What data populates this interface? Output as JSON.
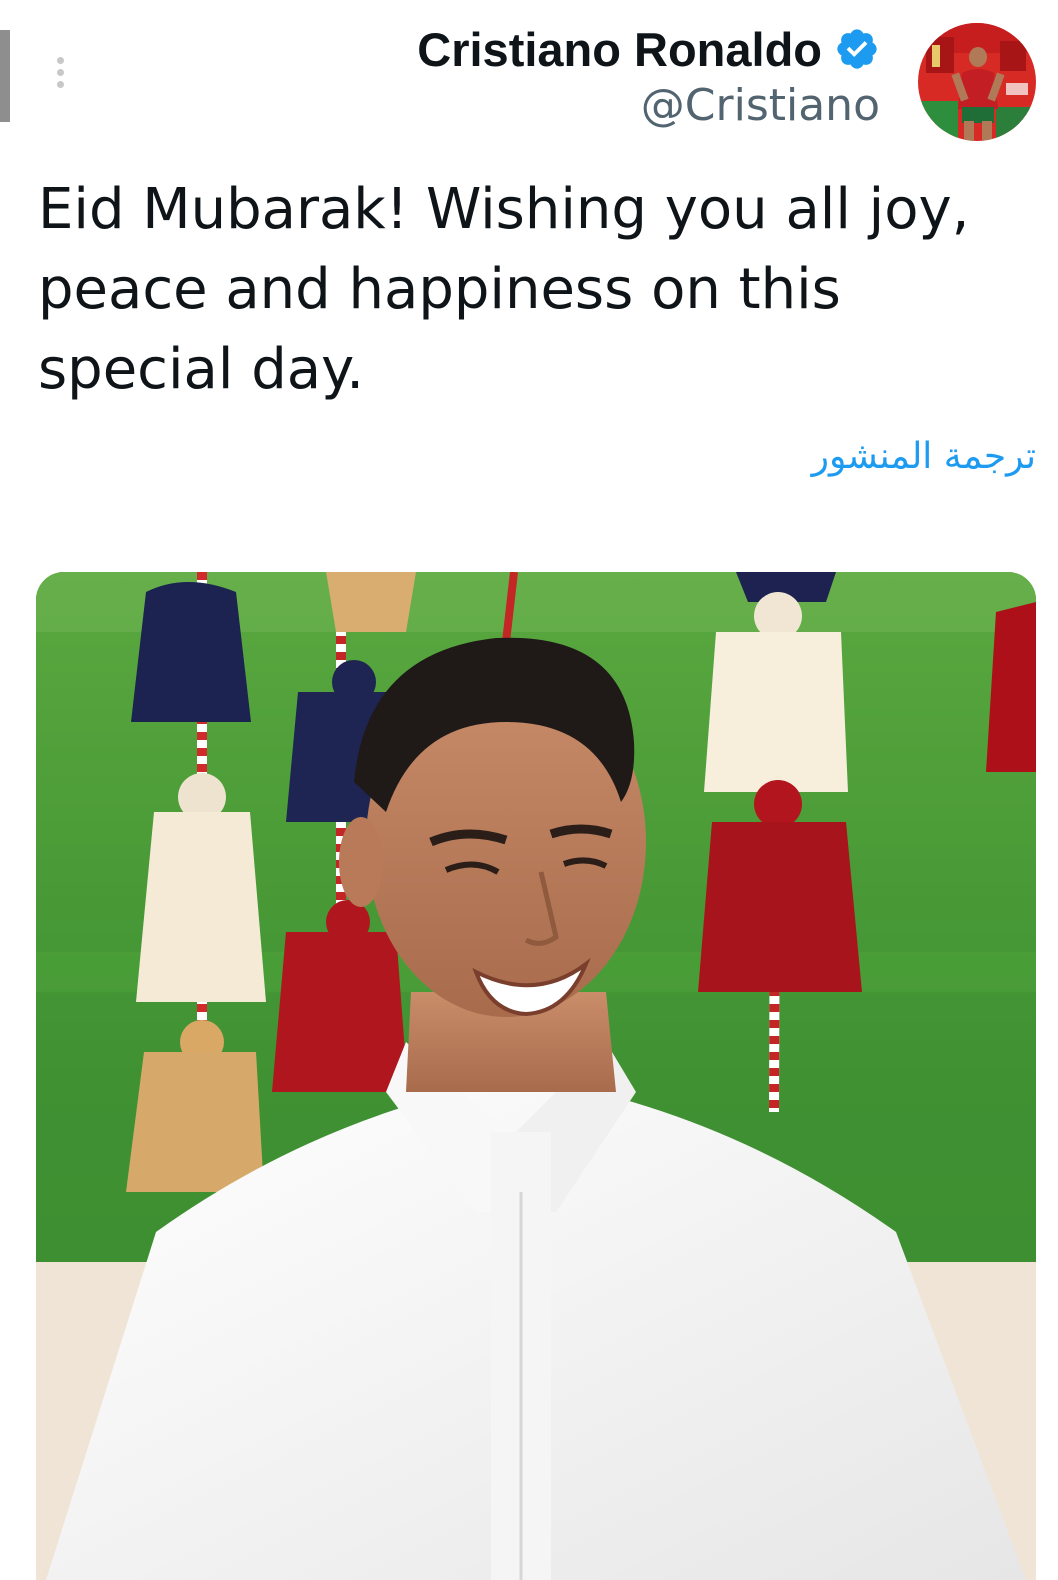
{
  "tweet": {
    "author_name": "Cristiano Ronaldo",
    "author_handle": "@Cristiano",
    "text": "Eid Mubarak! Wishing you all joy, peace and happiness on this special day.",
    "translate_label": "ترجمة المنشور"
  },
  "icons": {
    "more": "more-vertical-icon",
    "verified": "verified-badge-icon"
  },
  "colors": {
    "text_primary": "#0f1419",
    "text_secondary": "#536471",
    "link": "#1d9bf0",
    "verified": "#1d9bf0"
  }
}
